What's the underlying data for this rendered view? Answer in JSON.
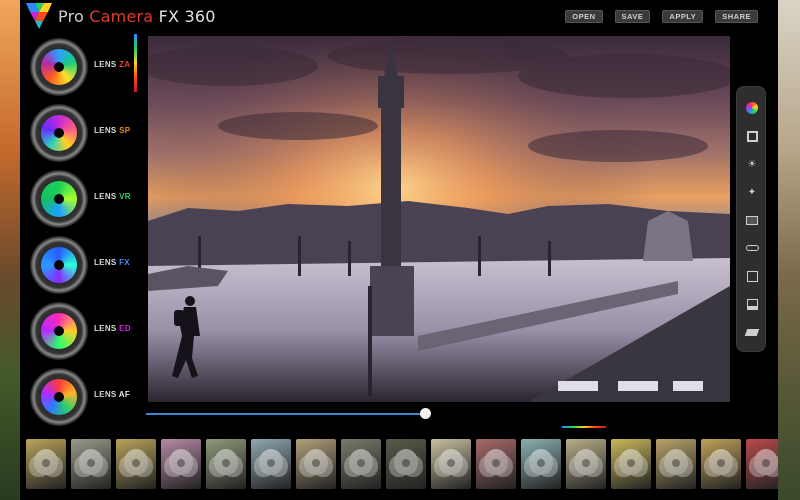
{
  "app": {
    "title_parts": [
      "Pro",
      "Camera",
      "FX",
      "360"
    ]
  },
  "toolbar": {
    "open_label": "OPEN",
    "save_label": "SAVE",
    "apply_label": "APPLY",
    "share_label": "SHARE"
  },
  "lenses": [
    {
      "prefix": "LENS",
      "suffix": "ZA",
      "suffix_color": "#e8402a",
      "glass": "conic-gradient(#2aa0ff,#1ad07a,#ffe12a,#ff5a1e,#b42aa8,#2aa0ff)"
    },
    {
      "prefix": "LENS",
      "suffix": "SP",
      "suffix_color": "#f08a1e",
      "glass": "conic-gradient(#c42ad8,#ff5a8a,#ffd21e,#2ad0c0,#6a2aff,#c42ad8)"
    },
    {
      "prefix": "LENS",
      "suffix": "VR",
      "suffix_color": "#2ed06a",
      "glass": "conic-gradient(#1ad05a,#a8ff2a,#1aa0ff,#16c060,#1ad05a)"
    },
    {
      "prefix": "LENS",
      "suffix": "FX",
      "suffix_color": "#3a8aff",
      "glass": "conic-gradient(#2a5aff,#2affd8,#8a2aff,#2a9aff,#2a5aff)"
    },
    {
      "prefix": "LENS",
      "suffix": "ED",
      "suffix_color": "#c42ad8",
      "glass": "conic-gradient(#ff2ab4,#ffd02a,#2aff6a,#b42aff,#ff2ab4)"
    },
    {
      "prefix": "LENS",
      "suffix": "AF",
      "suffix_color": "#e8e8e8",
      "glass": "conic-gradient(#ff3a3a,#ffb42a,#2ad06a,#2a7aff,#b42aff,#ff3a3a)"
    }
  ],
  "slider": {
    "value": 0.98
  },
  "tools": [
    "color-wheel-icon",
    "frame-icon",
    "brightness-icon",
    "magic-wand-icon",
    "layers-icon",
    "toggle-icon",
    "text-icon",
    "crop-icon",
    "eraser-icon"
  ],
  "filmstrip": [
    {
      "color": "#b9a45a"
    },
    {
      "color": "#9a9a8a"
    },
    {
      "color": "#b8a35c"
    },
    {
      "color": "#b68aa6"
    },
    {
      "color": "#8f9a7a"
    },
    {
      "color": "#8fa8b0"
    },
    {
      "color": "#b0a07a"
    },
    {
      "color": "#7a7a6a"
    },
    {
      "color": "#5a5a4a"
    },
    {
      "color": "#c8c0a0"
    },
    {
      "color": "#a86a6a"
    },
    {
      "color": "#8ab0b0"
    },
    {
      "color": "#b8b08a"
    },
    {
      "color": "#c8b85a"
    },
    {
      "color": "#b8a46a"
    },
    {
      "color": "#c0a05a"
    },
    {
      "color": "#b84a4a"
    }
  ]
}
